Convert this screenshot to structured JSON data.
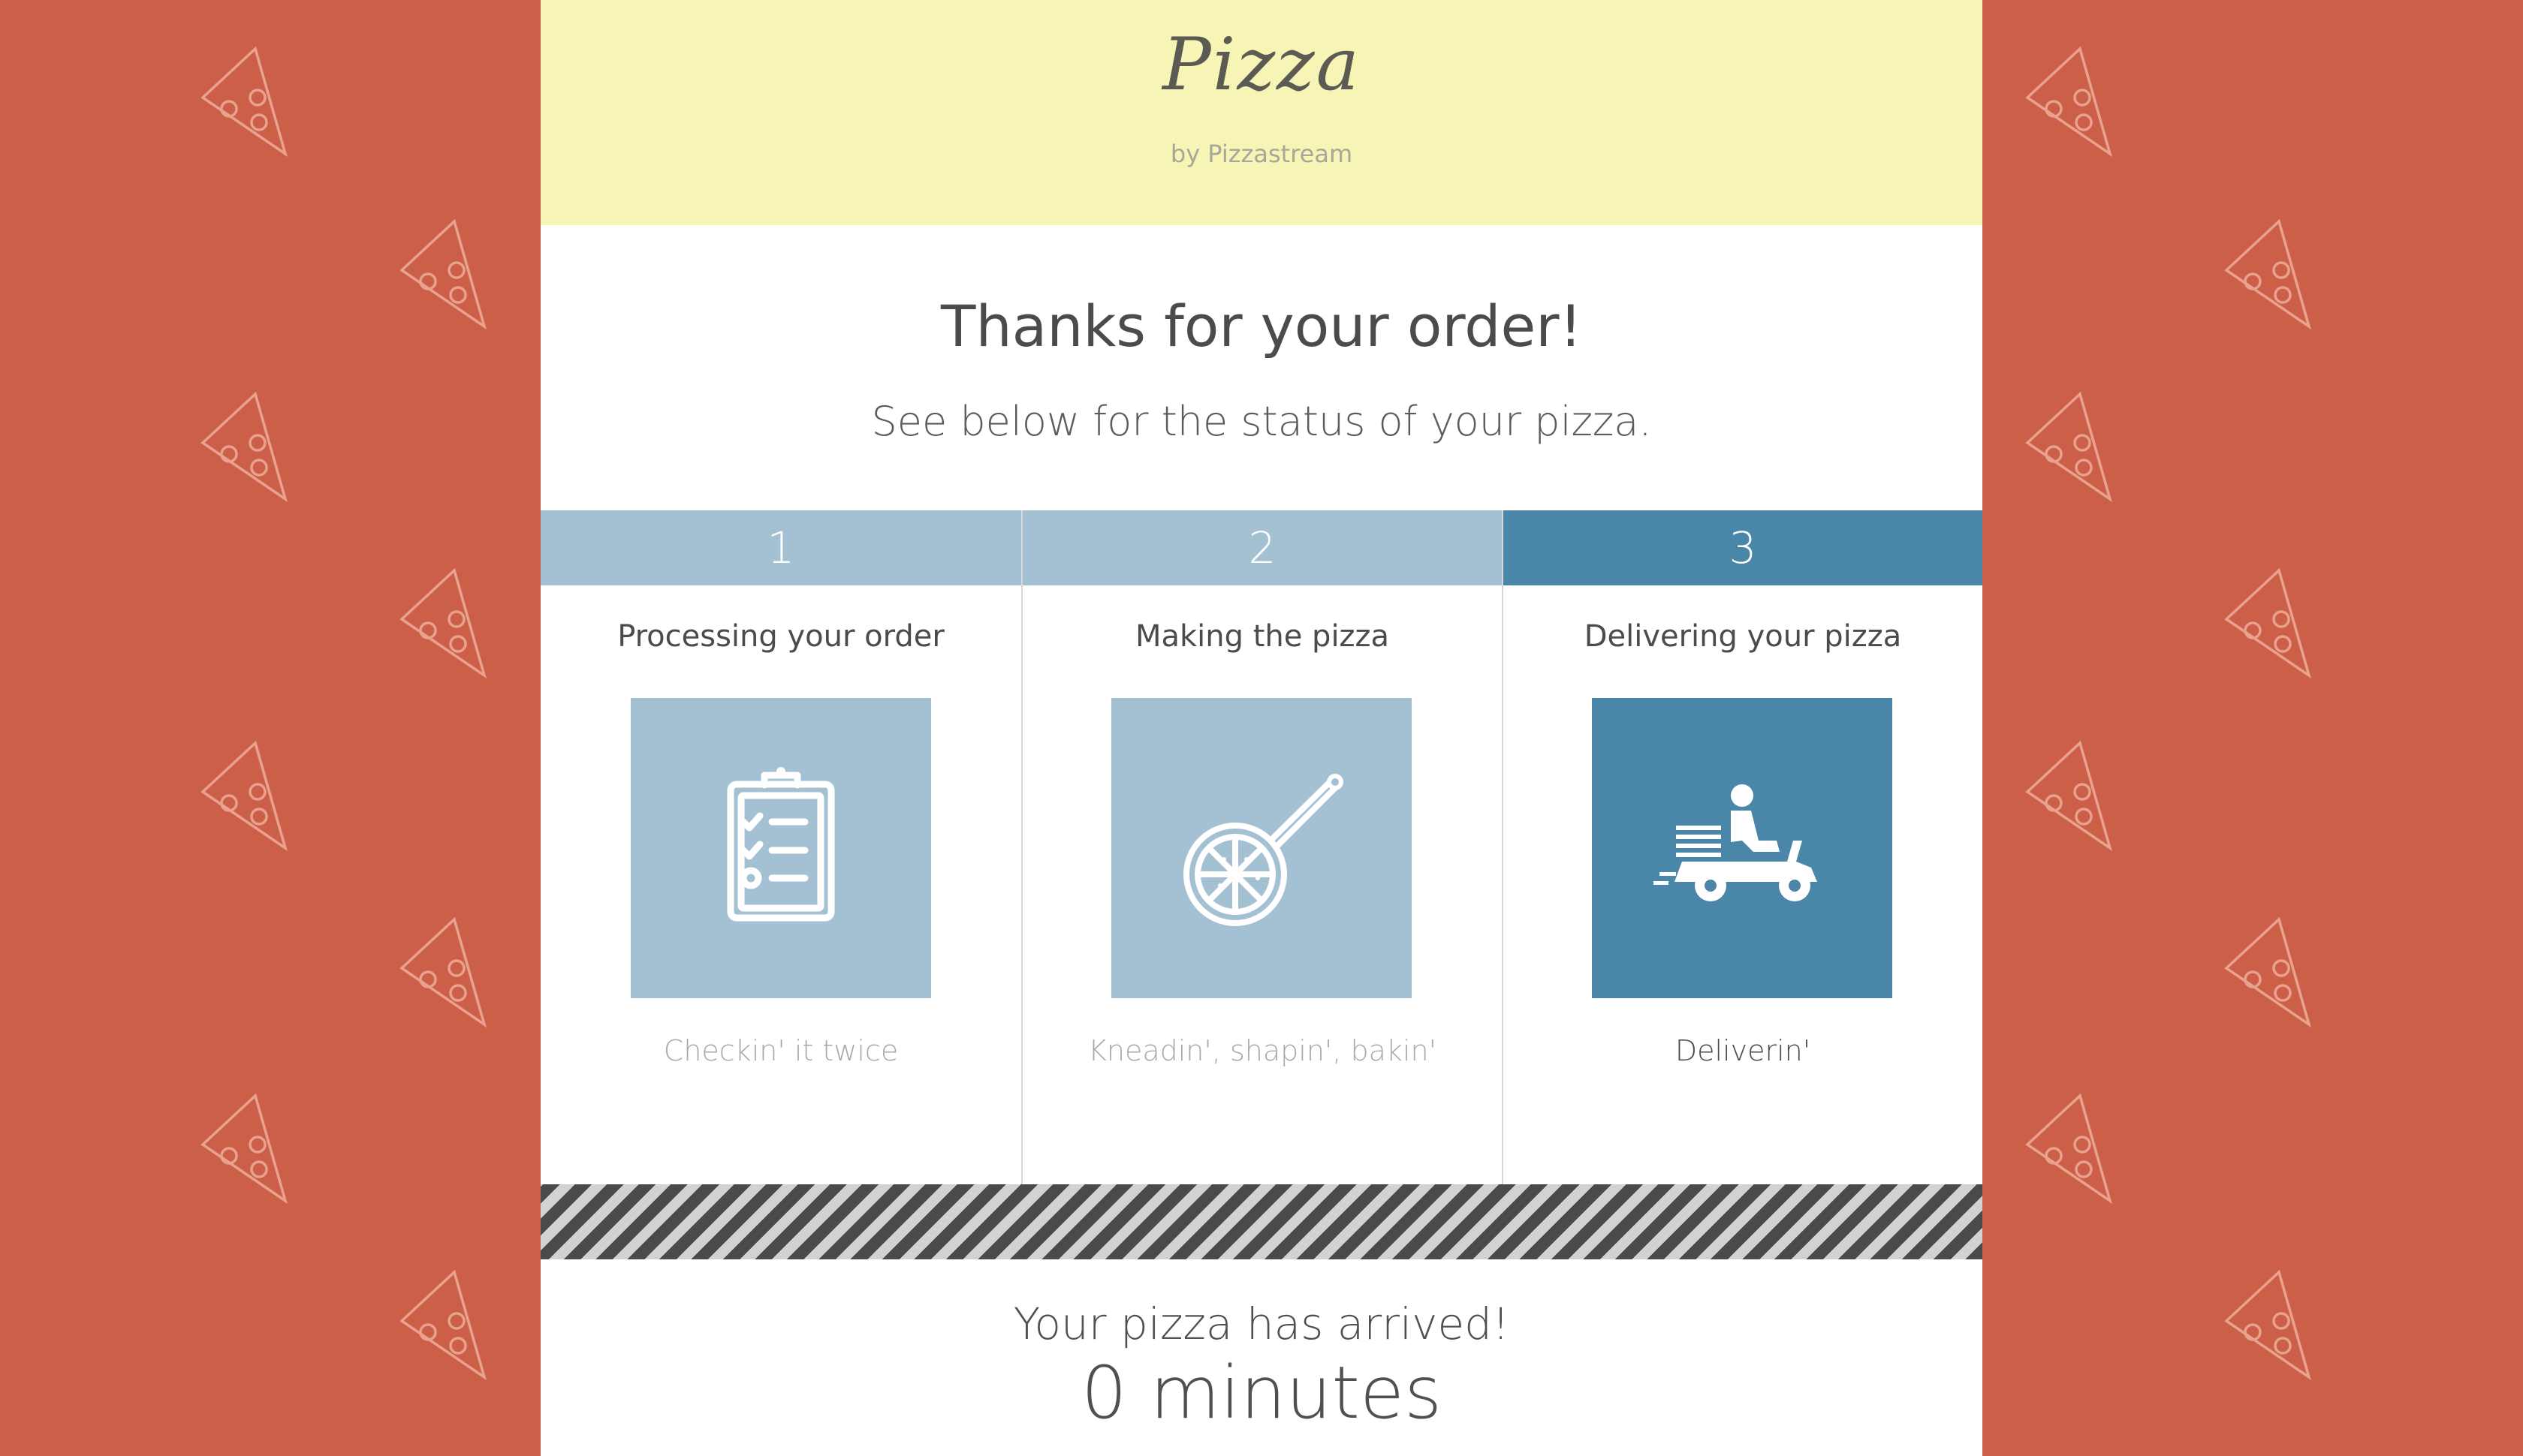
{
  "brand": {
    "name": "Pizza",
    "byline": "by Pizzastream"
  },
  "heading": {
    "title": "Thanks for your order!",
    "subtitle": "See below for the status of your pizza."
  },
  "steps": [
    {
      "number": "1",
      "title": "Processing your order",
      "caption": "Checkin' it twice",
      "icon": "clipboard-checklist-icon",
      "active": false
    },
    {
      "number": "2",
      "title": "Making the pizza",
      "caption": "Kneadin', shapin', bakin'",
      "icon": "pizza-peel-icon",
      "active": false
    },
    {
      "number": "3",
      "title": "Delivering your pizza",
      "caption": "Deliverin'",
      "icon": "delivery-scooter-icon",
      "active": true
    }
  ],
  "status": {
    "message": "Your pizza has arrived!",
    "eta": "0 minutes"
  },
  "colors": {
    "background": "#cc5f47",
    "header": "#f6f5b6",
    "step_inactive": "#a3c1d3",
    "step_active": "#4a86a8",
    "text": "#4b4b4b"
  }
}
